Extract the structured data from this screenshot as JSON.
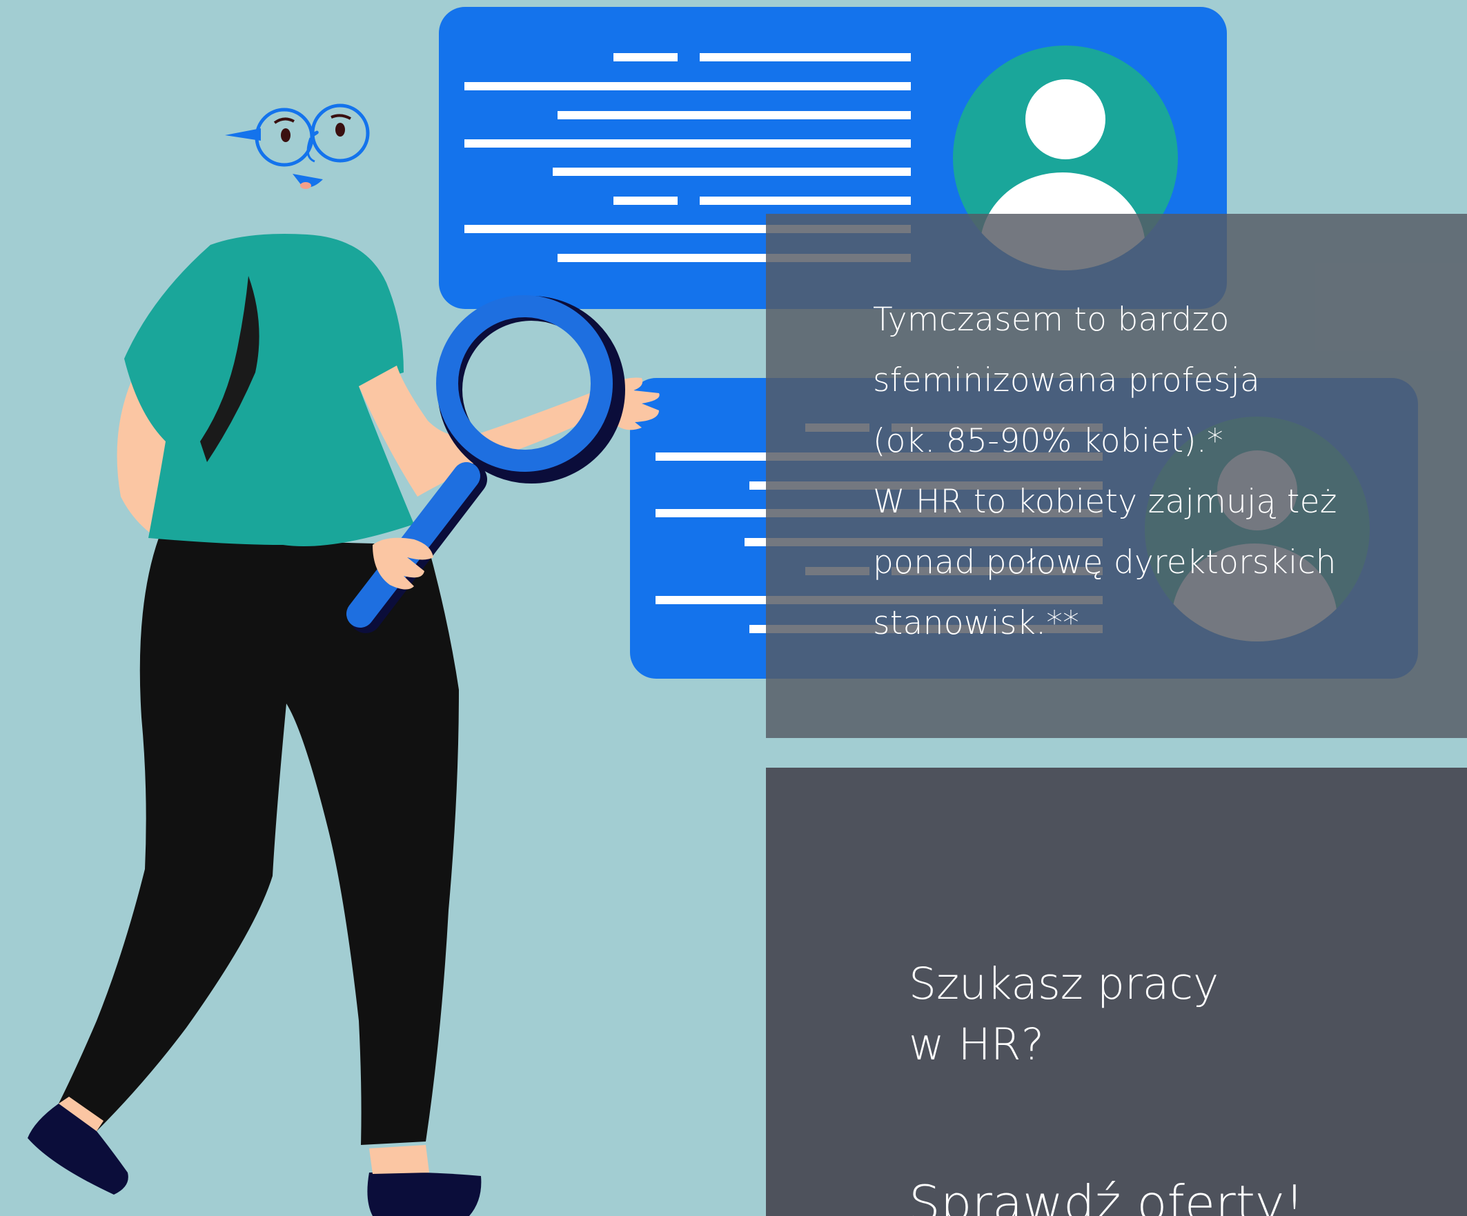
{
  "colors": {
    "background": "#a2cdd2",
    "card_blue": "#1473ec",
    "avatar_teal": "#1aa69a",
    "shirt": "#1aa69a",
    "pants": "#111111",
    "skin": "#fbc6a3",
    "overlay_top": "rgba(86,90,100,0.82)",
    "overlay_bottom": "#4e525c",
    "text": "#ffffff"
  },
  "icons": [
    "user-avatar-icon",
    "magnifying-glass-icon"
  ],
  "info_box": {
    "lines": [
      "Tymczasem to bardzo",
      "sfeminizowana profesja",
      "(ok. 85-90% kobiet).*",
      "W HR to kobiety zajmują też",
      "ponad połowę dyrektorskich",
      "stanowisk.**"
    ]
  },
  "cta": {
    "heading_line1": "Szukasz pracy",
    "heading_line2": "w HR?",
    "link": "Sprawdź oferty!"
  }
}
